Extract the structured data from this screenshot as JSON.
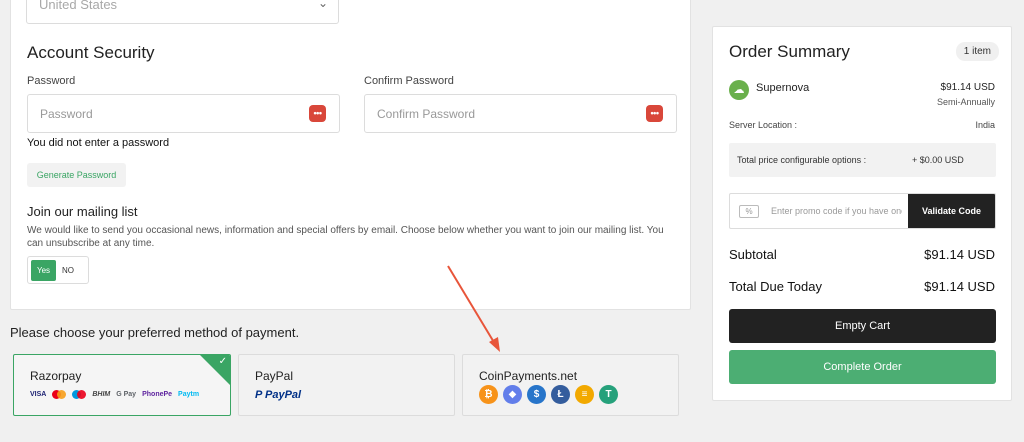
{
  "billing": {
    "country_value": "United States"
  },
  "security": {
    "title": "Account Security",
    "password_label": "Password",
    "password_placeholder": "Password",
    "confirm_label": "Confirm Password",
    "confirm_placeholder": "Confirm Password",
    "error": "You did not enter a password",
    "generate_label": "Generate Password"
  },
  "mailing": {
    "title": "Join our mailing list",
    "description": "We would like to send you occasional news, information and special offers by email. Choose below whether you want to join our mailing list. You can unsubscribe at any time.",
    "yes": "Yes",
    "no": "NO"
  },
  "payment": {
    "heading": "Please choose your preferred method of payment.",
    "methods": [
      {
        "name": "Razorpay",
        "selected": true,
        "logos": [
          "VISA",
          "Mastercard",
          "Maestro",
          "BHIM",
          "G Pay",
          "PhonePe",
          "Paytm"
        ]
      },
      {
        "name": "PayPal",
        "selected": false,
        "logo_text": "PayPal"
      },
      {
        "name": "CoinPayments.net",
        "selected": false,
        "coins": [
          "bitcoin-icon",
          "ethereum-icon",
          "usdc-icon",
          "litecoin-icon",
          "dash-icon",
          "tether-icon"
        ]
      }
    ]
  },
  "summary": {
    "title": "Order Summary",
    "items_badge": "1 item",
    "product_name": "Supernova",
    "product_price": "$91.14 USD",
    "product_cycle": "Semi-Annually",
    "location_label": "Server Location :",
    "location_value": "India",
    "config_label": "Total price configurable options :",
    "config_value": "+ $0.00 USD",
    "promo_placeholder": "Enter promo code if you have one",
    "validate_label": "Validate Code",
    "subtotal_label": "Subtotal",
    "subtotal_value": "$91.14 USD",
    "total_label": "Total Due Today",
    "total_value": "$91.14 USD",
    "empty_cart_label": "Empty Cart",
    "complete_label": "Complete Order"
  },
  "colors": {
    "accent_green": "#3aa564",
    "dark": "#222222",
    "danger": "#d9473a"
  }
}
